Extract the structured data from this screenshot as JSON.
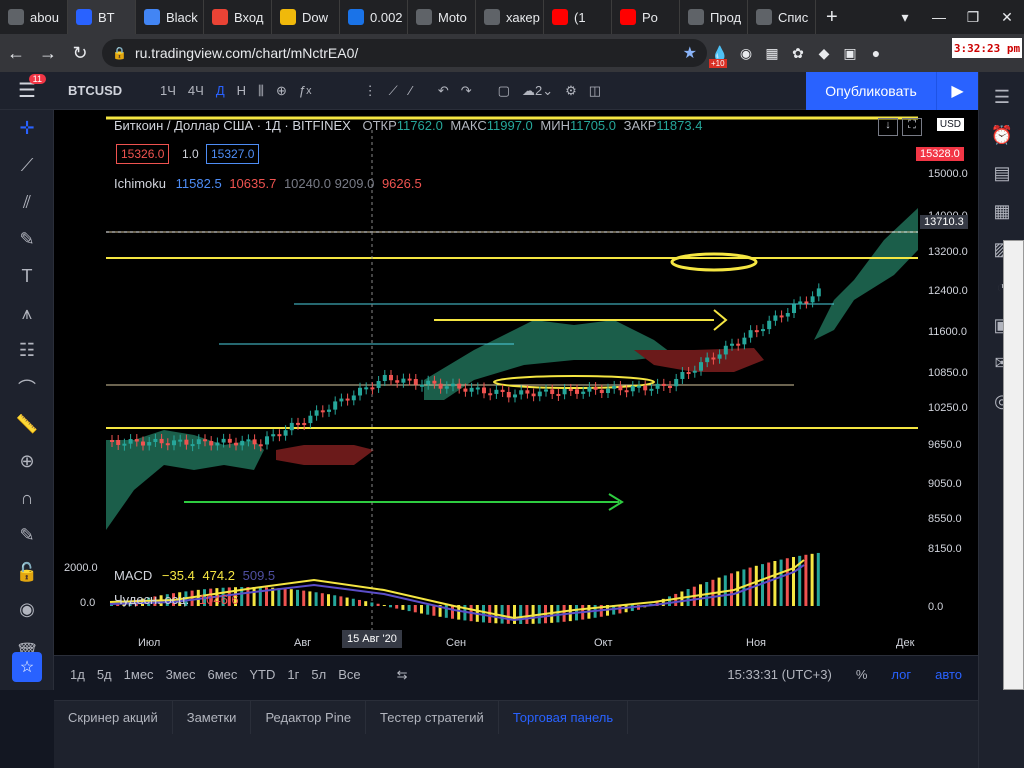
{
  "browser": {
    "tabs": [
      {
        "label": "abou",
        "favicon_color": "#5f6368"
      },
      {
        "label": "BT",
        "favicon_color": "#2962ff",
        "active": true
      },
      {
        "label": "Black",
        "favicon_color": "#4285f4"
      },
      {
        "label": "Вход",
        "favicon_color": "#ea4335"
      },
      {
        "label": "Dow",
        "favicon_color": "#f0b90b"
      },
      {
        "label": "0.002",
        "favicon_color": "#1a73e8"
      },
      {
        "label": "Moto",
        "favicon_color": "#5f6368"
      },
      {
        "label": "хакер",
        "favicon_color": "#5f6368"
      },
      {
        "label": "(1",
        "favicon_color": "#ff0000"
      },
      {
        "label": "Po",
        "favicon_color": "#ff0000"
      },
      {
        "label": "Прод",
        "favicon_color": "#5f6368"
      },
      {
        "label": "Спис",
        "favicon_color": "#5f6368"
      }
    ],
    "new_tab": "+",
    "url": "ru.tradingview.com/chart/mNctrEA0/",
    "clock": "3:32:23 pm",
    "ext_badge": "+10"
  },
  "toolbar": {
    "menu_badge": "11",
    "symbol": "BTCUSD",
    "intervals": [
      "1Ч",
      "4Ч",
      "Д",
      "Н"
    ],
    "active_interval": "Д",
    "layouts_count": "2",
    "publish_label": "Опубликовать"
  },
  "chart": {
    "title": "Биткоин / Доллар США · 1Д · BITFINEX",
    "ohlc": {
      "o_label": "ОТКР",
      "o": "11762.0",
      "h_label": "МАКС",
      "h": "11997.0",
      "l_label": "МИН",
      "l": "11705.0",
      "c_label": "ЗАКР",
      "c": "11873.4"
    },
    "sell_price": "15326.0",
    "qty": "1.0",
    "buy_price": "15327.0",
    "ichimoku": {
      "name": "Ichimoku",
      "v1": "11582.5",
      "v2": "10635.7",
      "v3": "10240.0",
      "v4": "9209.0",
      "v5": "9626.5"
    },
    "currency": "USD",
    "price_axis": [
      "15000.0",
      "14000.0",
      "13200.0",
      "12400.0",
      "11600.0",
      "10850.0",
      "10250.0",
      "9650.0",
      "9050.0",
      "8550.0",
      "8150.0"
    ],
    "current_price": "15328.0",
    "crosshair_price": "13710.3",
    "macd": {
      "name": "MACD",
      "v1": "−35.4",
      "v2": "474.2",
      "v3": "509.5",
      "axis_top": "2000.0",
      "axis_zero": "0.0"
    },
    "ao": {
      "name": "Чудесн. осц.",
      "v": "1046.6",
      "axis": "0.0"
    },
    "time_axis": [
      "Июл",
      "Авг",
      "Сен",
      "Окт",
      "Ноя",
      "Дек"
    ],
    "crosshair_date": "15 Авг '20",
    "colors": {
      "up": "#26a69a",
      "down": "#ef5350",
      "cloud_up": "#1b5e4a",
      "cloud_down": "#6b1a1a",
      "yellow": "#f5e642"
    }
  },
  "range_bar": {
    "ranges": [
      "1д",
      "5д",
      "1мес",
      "3мес",
      "6мес",
      "YTD",
      "1г",
      "5л",
      "Все"
    ],
    "time": "15:33:31 (UTC+3)",
    "percent": "%",
    "log": "лог",
    "auto": "авто"
  },
  "bottom_tabs": [
    "Скринер акций",
    "Заметки",
    "Редактор Pine",
    "Тестер стратегий",
    "Торговая панель"
  ],
  "active_bottom_tab": "Торговая панель"
}
